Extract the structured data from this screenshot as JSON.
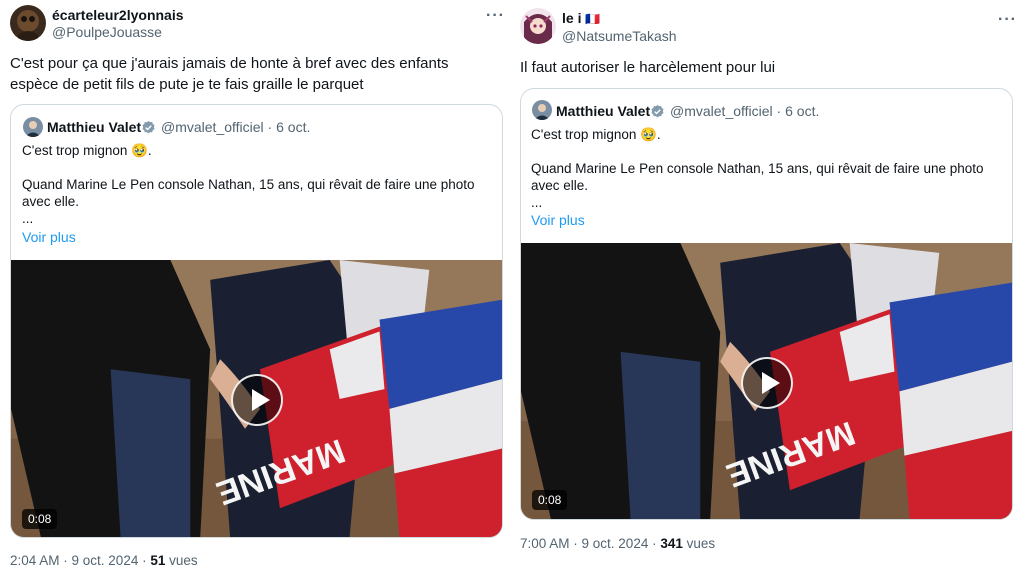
{
  "tweets": [
    {
      "author_name": "écarteleur2lyonnais",
      "author_handle": "@PoulpeJouasse",
      "text": "C'est pour ça que j'aurais jamais de honte à bref avec des enfants espèce de petit fils de pute je te fais graille le parquet",
      "quote": {
        "name": "Matthieu Valet",
        "handle_date": "@mvalet_officiel · 6 oct.",
        "text": "C'est trop mignon 🥹.\n\nQuand Marine Le Pen console Nathan, 15 ans, qui rêvait de faire une photo avec elle.\n...",
        "see_more": "Voir plus",
        "video_duration": "0:08"
      },
      "time": "2:04 AM · 9 oct. 2024 · ",
      "views_count": "51",
      "views_label": " vues"
    },
    {
      "author_name": "le i",
      "author_flag": "🇫🇷",
      "author_handle": "@NatsumeTakash",
      "text": "Il faut autoriser le harcèlement pour lui",
      "quote": {
        "name": "Matthieu Valet",
        "handle_date": "@mvalet_officiel · 6 oct.",
        "text": "C'est trop mignon 🥹.\n\nQuand Marine Le Pen console Nathan, 15 ans, qui rêvait de faire une photo avec elle.\n...",
        "see_more": "Voir plus",
        "video_duration": "0:08"
      },
      "time": "7:00 AM · 9 oct. 2024 · ",
      "views_count": "341",
      "views_label": " vues"
    }
  ],
  "icons": {
    "more": "more-horizontal-icon",
    "verified": "verified-badge-icon",
    "play": "play-icon"
  },
  "colors": {
    "link": "#1d9bf0",
    "secondary_text": "#536471",
    "border": "#cfd9de",
    "verified": "#829aab"
  }
}
